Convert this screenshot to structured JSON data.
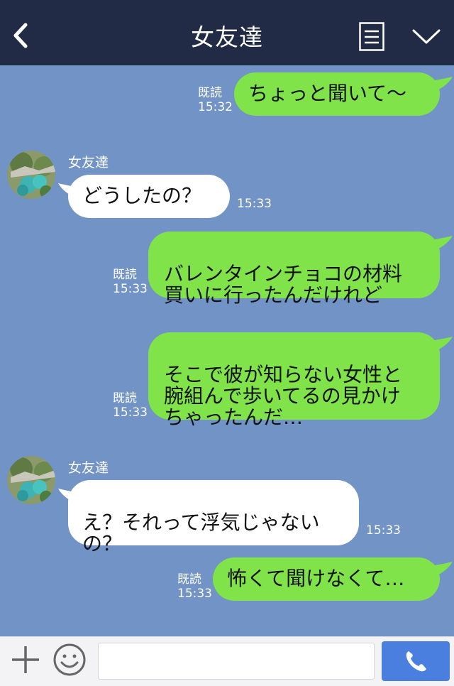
{
  "header": {
    "title": "女友達"
  },
  "messages": [
    {
      "text": "ちょっと聞いて〜",
      "read": "既読",
      "time": "15:32"
    },
    {
      "sender": "女友達",
      "text": "どうしたの？",
      "time": "15:33"
    },
    {
      "text": "バレンタインチョコの材料\n買いに行ったんだけれど",
      "read": "既読",
      "time": "15:33"
    },
    {
      "text": "そこで彼が知らない女性と\n腕組んで歩いてるの見かけ\nちゃったんだ…",
      "read": "既読",
      "time": "15:33"
    },
    {
      "sender": "女友達",
      "text": "え？それって浮気じゃない\nの？",
      "time": "15:33"
    },
    {
      "text": "怖くて聞けなくて…",
      "read": "既読",
      "time": "15:33"
    }
  ],
  "footer": {
    "input_placeholder": ""
  },
  "colors": {
    "header_bg": "#222b45",
    "chat_bg": "#7293c6",
    "my_bubble": "#7fe349",
    "their_bubble": "#ffffff",
    "send_button": "#4a7fe0"
  }
}
